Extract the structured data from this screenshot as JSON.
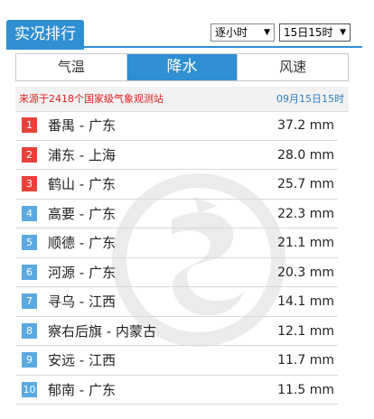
{
  "header": {
    "title": "实况排行",
    "mode_select": "逐小时",
    "time_select": "15日15时"
  },
  "tabs": [
    {
      "label": "气温",
      "active": false
    },
    {
      "label": "降水",
      "active": true
    },
    {
      "label": "风速",
      "active": false
    }
  ],
  "source": {
    "text": "来源于2418个国家级气象观测站",
    "time": "09月15日15时"
  },
  "colors": {
    "accent": "#2f8fd3",
    "top_rank": "#e8413a",
    "rank": "#5aa9e0",
    "source_text": "#e02020"
  },
  "rankings": [
    {
      "rank": "1",
      "station": "番禺 - 广东",
      "value": "37.2 mm"
    },
    {
      "rank": "2",
      "station": "浦东 - 上海",
      "value": "28.0 mm"
    },
    {
      "rank": "3",
      "station": "鹤山 - 广东",
      "value": "25.7 mm"
    },
    {
      "rank": "4",
      "station": "高要 - 广东",
      "value": "22.3 mm"
    },
    {
      "rank": "5",
      "station": "顺德 - 广东",
      "value": "21.1 mm"
    },
    {
      "rank": "6",
      "station": "河源 - 广东",
      "value": "20.3 mm"
    },
    {
      "rank": "7",
      "station": "寻乌 - 江西",
      "value": "14.1 mm"
    },
    {
      "rank": "8",
      "station": "察右后旗 - 内蒙古",
      "value": "12.1 mm"
    },
    {
      "rank": "9",
      "station": "安远 - 江西",
      "value": "11.7 mm"
    },
    {
      "rank": "10",
      "station": "郁南 - 广东",
      "value": "11.5 mm"
    }
  ]
}
